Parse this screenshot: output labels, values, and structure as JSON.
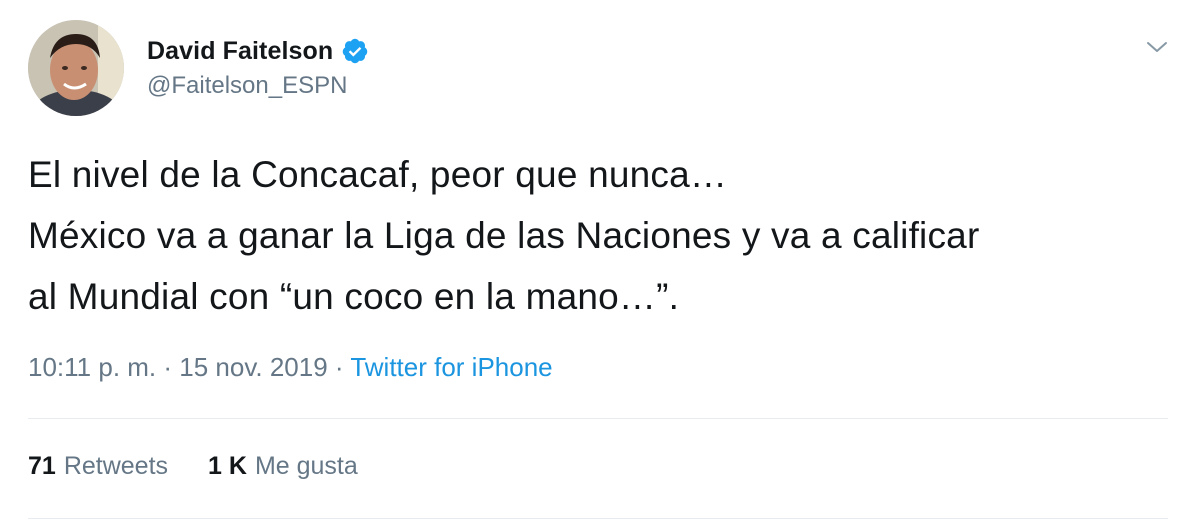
{
  "author": {
    "display_name": "David Faitelson",
    "handle": "@Faitelson_ESPN",
    "verified": true
  },
  "tweet": {
    "lines": [
      "El nivel de la Concacaf, peor que nunca…",
      "México va a ganar la Liga de las Naciones y va a calificar",
      "al Mundial con “un coco en la mano…”."
    ]
  },
  "meta": {
    "time": "10:11 p. m.",
    "separator": " · ",
    "date": "15 nov. 2019",
    "source": "Twitter for iPhone"
  },
  "stats": {
    "retweets_count": "71",
    "retweets_label": "Retweets",
    "likes_count": "1 K",
    "likes_label": "Me gusta"
  },
  "icons": {
    "verified": "verified-badge-icon",
    "more": "chevron-down-icon"
  },
  "colors": {
    "text": "#14171a",
    "secondary": "#657786",
    "link": "#1b95e0",
    "verified": "#1da1f2",
    "divider": "#e6ecf0"
  }
}
